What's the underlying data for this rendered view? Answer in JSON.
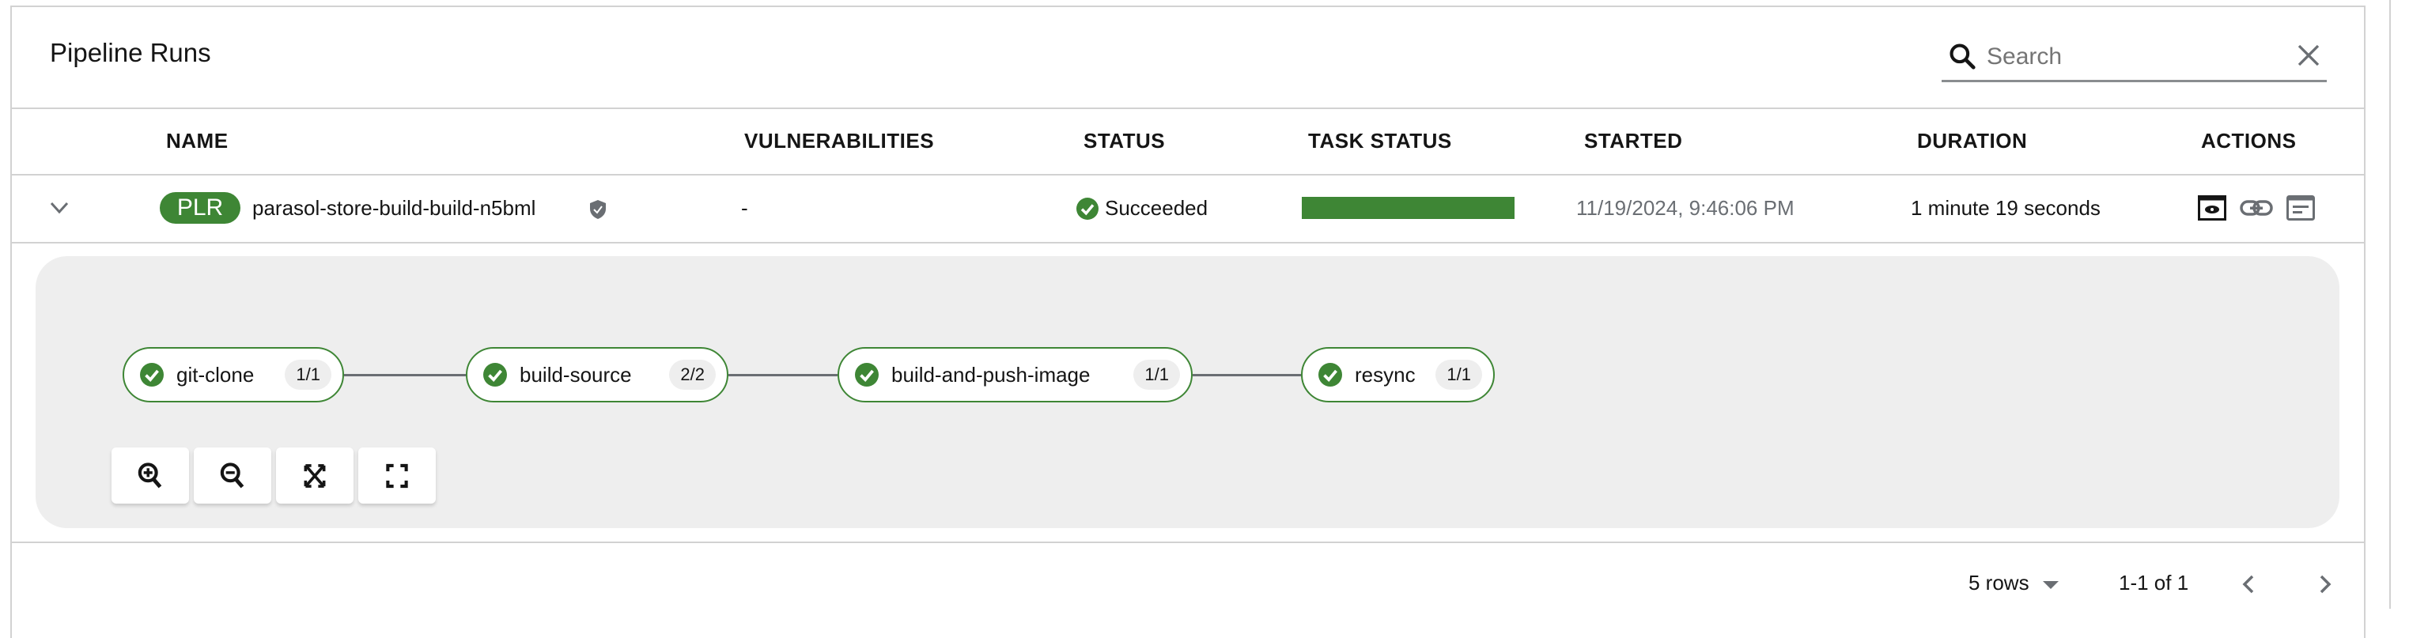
{
  "header": {
    "title": "Pipeline Runs",
    "search_placeholder": "Search"
  },
  "table": {
    "columns": [
      "NAME",
      "VULNERABILITIES",
      "STATUS",
      "TASK STATUS",
      "STARTED",
      "DURATION",
      "ACTIONS"
    ],
    "rows": [
      {
        "badge": "PLR",
        "name": "parasol-store-build-build-n5bml",
        "vulnerabilities": "-",
        "status": "Succeeded",
        "task_status_percent": 100,
        "started": "11/19/2024, 9:46:06 PM",
        "duration": "1 minute 19 seconds",
        "actions": [
          "view-logs-icon",
          "link-icon",
          "summary-icon"
        ]
      }
    ]
  },
  "pipeline": {
    "tasks": [
      {
        "name": "git-clone",
        "count": "1/1"
      },
      {
        "name": "build-source",
        "count": "2/2"
      },
      {
        "name": "build-and-push-image",
        "count": "1/1"
      },
      {
        "name": "resync",
        "count": "1/1"
      }
    ],
    "controls": [
      "zoom-in-icon",
      "zoom-out-icon",
      "fit-to-screen-icon",
      "reset-view-icon"
    ]
  },
  "pagination": {
    "per_page": "5 rows",
    "range": "1-1 of 1"
  },
  "colors": {
    "success": "#3e8635",
    "panel": "#eeeeee",
    "border": "#d2d2d2"
  }
}
